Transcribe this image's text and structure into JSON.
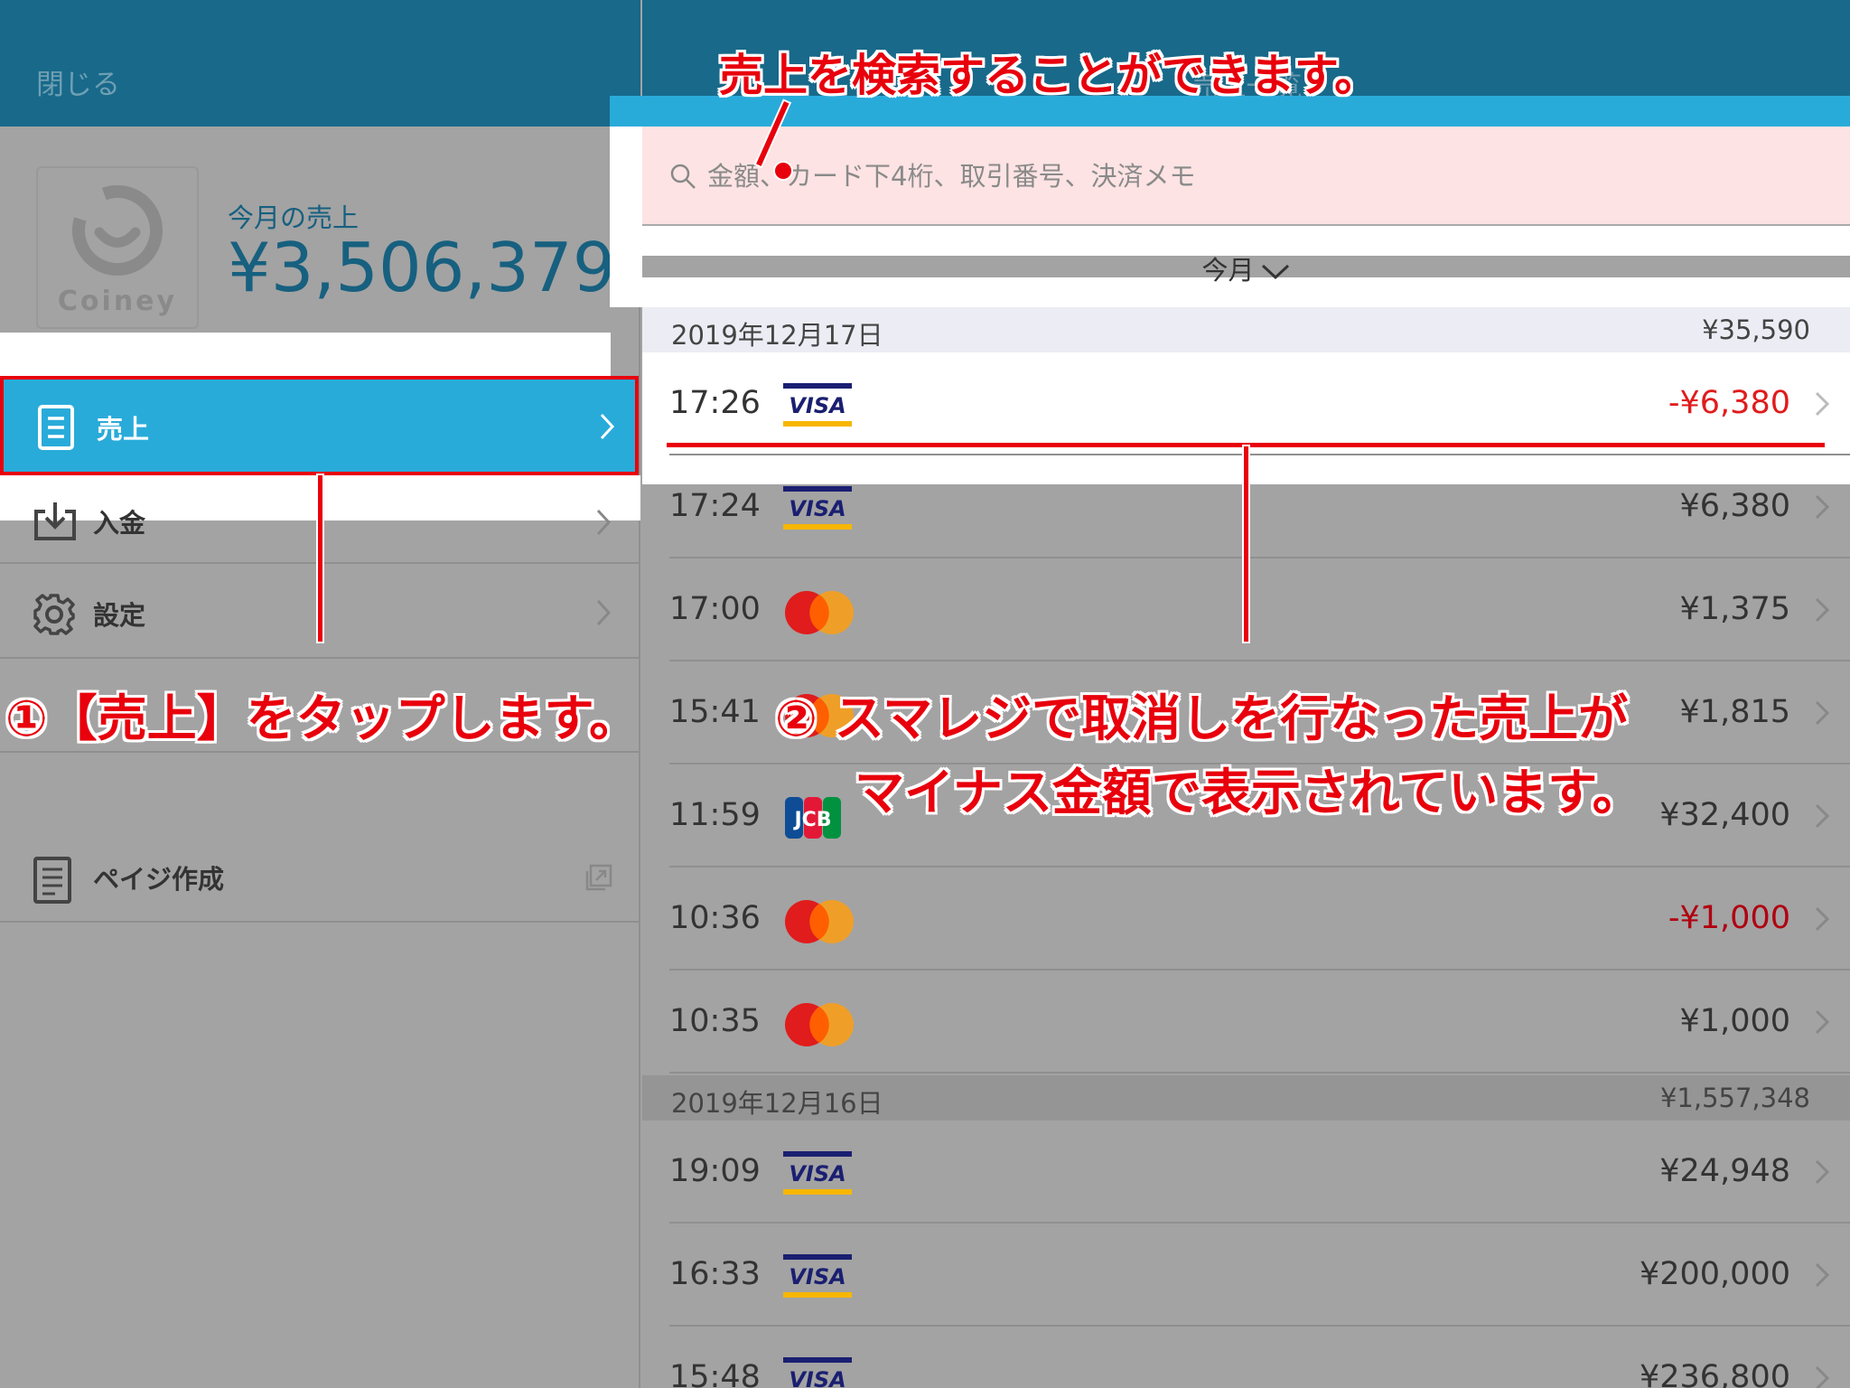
{
  "sidebar": {
    "close_label": "閉じる",
    "logo_text": "Coiney",
    "month_label": "今月の売上",
    "month_total": "¥3,506,379",
    "menu": [
      {
        "label": "売上",
        "icon": "document-icon",
        "active": true
      },
      {
        "label": "入金",
        "icon": "download-tray-icon"
      },
      {
        "label": "設定",
        "icon": "gear-icon"
      },
      {
        "label": "ペイジ作成",
        "icon": "page-icon"
      }
    ]
  },
  "main": {
    "title": "売上一覧",
    "search_placeholder": "金額、カード下4桁、取引番号、決済メモ",
    "period_label": "今月",
    "groups": [
      {
        "date": "2019年12月17日",
        "total": "¥35,590",
        "rows": [
          {
            "time": "17:26",
            "brand": "VISA",
            "amount": "-¥6,380",
            "negative": true
          },
          {
            "time": "17:24",
            "brand": "VISA",
            "amount": "¥6,380"
          },
          {
            "time": "17:00",
            "brand": "Mastercard",
            "amount": "¥1,375"
          },
          {
            "time": "15:41",
            "brand": "Mastercard",
            "amount": "¥1,815"
          },
          {
            "time": "11:59",
            "brand": "JCB",
            "amount": "¥32,400"
          },
          {
            "time": "10:36",
            "brand": "Mastercard",
            "amount": "-¥1,000",
            "negative": true
          },
          {
            "time": "10:35",
            "brand": "Mastercard",
            "amount": "¥1,000"
          }
        ]
      },
      {
        "date": "2019年12月16日",
        "total": "¥1,557,348",
        "rows": [
          {
            "time": "19:09",
            "brand": "VISA",
            "amount": "¥24,948"
          },
          {
            "time": "16:33",
            "brand": "VISA",
            "amount": "¥200,000"
          },
          {
            "time": "15:48",
            "brand": "VISA",
            "amount": "¥236,800"
          }
        ]
      }
    ]
  },
  "annotations": {
    "search_note": "売上を検索することができます。",
    "tap_note": "①【売上】をタップします。",
    "minus_note_line1": "② スマレジで取消しを行なった売上が",
    "minus_note_line2": "マイナス金額で表示されています。"
  },
  "colors": {
    "header": "#18698a",
    "accent": "#29abda",
    "annotation": "#e8000c",
    "negative_amount": "#e01c1c"
  }
}
